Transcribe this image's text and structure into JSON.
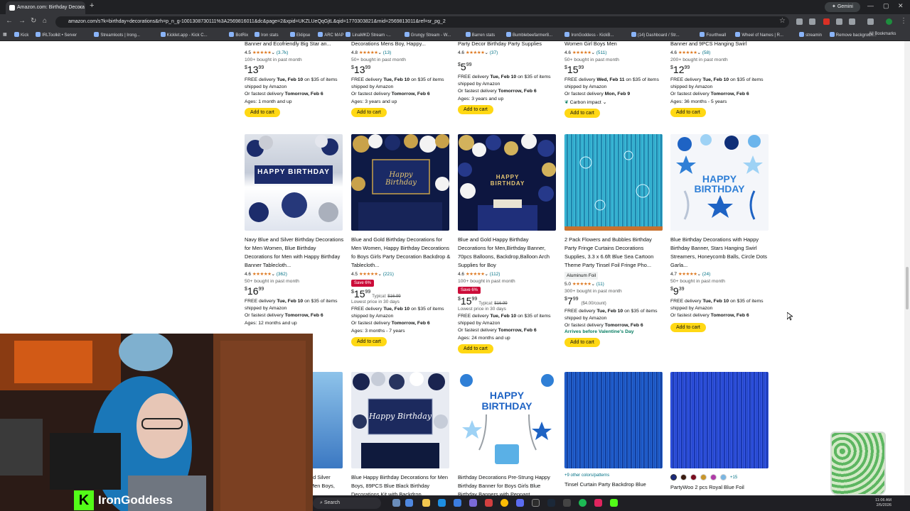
{
  "browser": {
    "tab_title": "Amazon.com: Birthday Decora",
    "url": "amazon.com/s?k=birthday+decorations&rh=p_n_g-1001308730111%3A2569816011&dc&page=2&xpid=UKZLUeQqGjtL&qid=1770303821&rnid=2569813011&ref=sr_pg_2",
    "gemini_label": "Gemini",
    "bookmarks": [
      "Kick",
      "IRLToolkit • Server",
      "Streamloots | Irong...",
      "Kicklet.app - Kick C...",
      "BotRix",
      "Iron stats",
      "Eklipse",
      "ARC MAP",
      "LinaMKD Stream -...",
      "Grungy Stream - W...",
      "Barren stats",
      "Bumblebeefarmer8...",
      "IronGoddess - KickB...",
      "(14) Dashboard / Str...",
      "Fourthwall",
      "Wheel of Names | R...",
      "streamin",
      "Remove backgroun..."
    ],
    "all_bookmarks": "All Bookmarks"
  },
  "cart_label": "Add to cart",
  "row1": [
    {
      "title": "Banner and Ecofriendly Big Star an...",
      "rating_count": "(3.7k)",
      "rating": "4.5",
      "bought": "100+ bought in past month",
      "price_whole": "13",
      "price_frac": "99",
      "d1": "FREE delivery ",
      "d1b": "Tue, Feb 10",
      "d1c": " on $35 of items shipped by Amazon",
      "d2": "Or fastest delivery ",
      "d2b": "Tomorrow, Feb 6",
      "ages": "Ages: 1 month and up"
    },
    {
      "title": "Decorations Mens Boy, Happy...",
      "rating_count": "(13)",
      "rating": "4.8",
      "bought": "50+ bought in past month",
      "price_whole": "13",
      "price_frac": "99",
      "d1": "FREE delivery ",
      "d1b": "Tue, Feb 10",
      "d1c": " on $35 of items shipped by Amazon",
      "d2": "Or fastest delivery ",
      "d2b": "Tomorrow, Feb 6",
      "ages": "Ages: 3 years and up"
    },
    {
      "title": "Party Decor Birthday Party Supplies",
      "rating_count": "(37)",
      "rating": "4.6",
      "bought": "",
      "price_whole": "5",
      "price_frac": "99",
      "d1": "FREE delivery ",
      "d1b": "Tue, Feb 10",
      "d1c": " on $35 of items shipped by Amazon",
      "d2": "Or fastest delivery ",
      "d2b": "Tomorrow, Feb 6",
      "ages": "Ages: 3 years and up"
    },
    {
      "title": "Women Girl Boys Men",
      "rating_count": "(511)",
      "rating": "4.6",
      "bought": "50+ bought in past month",
      "price_whole": "15",
      "price_frac": "99",
      "d1": "FREE delivery ",
      "d1b": "Wed, Feb 11",
      "d1c": " on $35 of items shipped by Amazon",
      "d2": "Or fastest delivery ",
      "d2b": "Mon, Feb 9",
      "ages": "",
      "carbon": "Carbon impact"
    },
    {
      "title": "Banner and 9PCS Hanging Swirl",
      "rating_count": "(58)",
      "rating": "4.6",
      "bought": "200+ bought in past month",
      "price_whole": "12",
      "price_frac": "99",
      "d1": "FREE delivery ",
      "d1b": "Tue, Feb 10",
      "d1c": " on $35 of items shipped by Amazon",
      "d2": "Or fastest delivery ",
      "d2b": "Tomorrow, Feb 6",
      "ages": "Ages: 36 months - 5 years"
    }
  ],
  "row2": [
    {
      "title": "Navy Blue and Silver Birthday Decorations for Men Women, Blue Birthday Decorations for Men with Happy Birthday Banner Tablecloth...",
      "rating": "4.6",
      "rating_count": "(362)",
      "bought": "50+ bought in past month",
      "price_whole": "16",
      "price_frac": "99",
      "d1": "FREE delivery ",
      "d1b": "Tue, Feb 10",
      "d1c": " on $35 of items shipped by Amazon",
      "d2": "Or fastest delivery ",
      "d2b": "Tomorrow, Feb 6",
      "ages": "Ages: 12 months and up"
    },
    {
      "title": "Blue and Gold Birthday Decorations for Men Women, Happy Birthday Decorations fo Boys Girls Party Decoration Backdrop & Tablecloth...",
      "rating": "4.5",
      "rating_count": "(221)",
      "save": "Save 6%",
      "price_whole": "15",
      "price_frac": "99",
      "typical_label": "Typical: ",
      "typical": "$16.99",
      "lowest": "Lowest price in 30 days",
      "d1": "FREE delivery ",
      "d1b": "Tue, Feb 10",
      "d1c": " on $35 of items shipped by Amazon",
      "d2": "Or fastest delivery ",
      "d2b": "Tomorrow, Feb 6",
      "ages": "Ages: 3 months - 7 years"
    },
    {
      "title": "Blue and Gold Happy Birthday Decorations for Men,Birthday Banner, 70pcs Balloons, Backdrop,Balloon Arch Supplies for Boy",
      "rating": "4.6",
      "rating_count": "(112)",
      "bought": "100+ bought in past month",
      "save": "Save 6%",
      "price_whole": "15",
      "price_frac": "99",
      "typical_label": "Typical: ",
      "typical": "$16.99",
      "lowest": "Lowest price in 30 days",
      "d1": "FREE delivery ",
      "d1b": "Tue, Feb 10",
      "d1c": " on $35 of items shipped by Amazon",
      "d2": "Or fastest delivery ",
      "d2b": "Tomorrow, Feb 6",
      "ages": "Ages: 24 months and up"
    },
    {
      "title": "2 Pack Flowers and Bubbles Birthday Party Fringe Curtains Decorations Supplies, 3.3 x 6.6ft Blue Sea Cartoon Theme Party Tinsel Foil Fringe Pho...",
      "badge": "Aluminum Foil",
      "rating": "5.0",
      "rating_count": "(11)",
      "bought": "300+ bought in past month",
      "price_whole": "7",
      "price_frac": "99",
      "unit": "($4.00/count)",
      "d1": "FREE delivery ",
      "d1b": "Tue, Feb 10",
      "d1c": " on $35 of items shipped by Amazon",
      "d2": "Or fastest delivery ",
      "d2b": "Tomorrow, Feb 6",
      "valentine": "Arrives before Valentine's Day"
    },
    {
      "title": "Blue Birthday Decorations with Happy Birthday Banner, Stars Hanging Swirl Streamers, Honeycomb Balls, Circle Dots Garla...",
      "rating": "4.7",
      "rating_count": "(24)",
      "bought": "50+ bought in past month",
      "price_whole": "9",
      "price_frac": "39",
      "d1": "FREE delivery ",
      "d1b": "Tue, Feb 10",
      "d1c": " on $35 of items shipped by Amazon",
      "d2": "Or fastest delivery ",
      "d2b": "Tomorrow, Feb 6"
    }
  ],
  "row3": [
    {
      "title_partial": "nd Silver",
      "title2": "Men Boys,"
    },
    {
      "title": "Blue Happy Birthday Decorations for Men Boys, 89PCS Blue Black Birthday Decorations Kit with Backdrop..."
    },
    {
      "title": "Birthday Decorations Pre-Strung Happy Birthday Banner for Boys Girls Blue Birthday Banners with Pennant..."
    },
    {
      "colors_link": "+9 other colors/patterns",
      "title": "Tinsel Curtain Party Backdrop Blue"
    },
    {
      "more": "+15",
      "title": "PartyWoo 2 pcs Royal Blue Foil"
    }
  ],
  "thumb_text": {
    "hb1": "HAPPY BIRTHDAY",
    "hb2": "Happy Birthday",
    "hb3": "HAPPY BIRTHDAY",
    "hb5": "HAPPY BIRTHDAY",
    "hb7": "Happy Birthday",
    "hb8": "HAPPY BIRTHDAY"
  },
  "streamer": {
    "name": "IronGoddess"
  },
  "taskbar": {
    "search": "Search",
    "time": "11:06 AM",
    "date": "2/5/2026"
  },
  "colors": {
    "cart": "#ffd814",
    "save": "#cc0c39",
    "link": "#007185",
    "star": "#de7921"
  }
}
